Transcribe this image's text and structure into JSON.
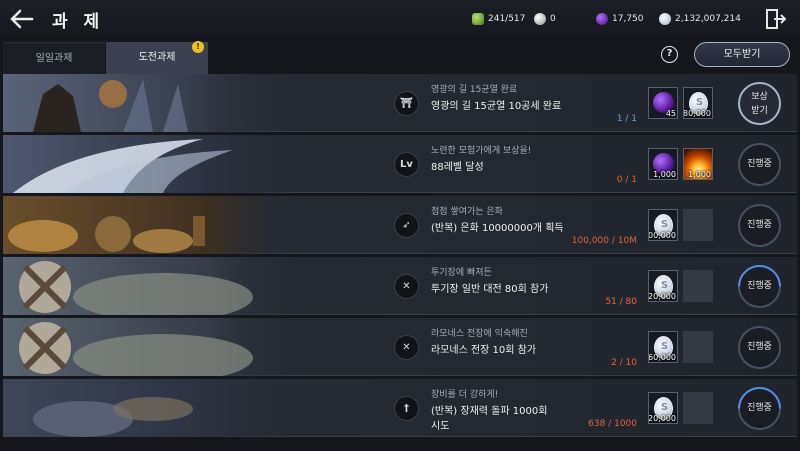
{
  "header": {
    "title": "과 제"
  },
  "resources": [
    {
      "icon": "green-gem-icon",
      "value": "241/517",
      "color": "#7ab648"
    },
    {
      "icon": "pearl-icon",
      "value": "0",
      "color": "#d0d0d0"
    },
    {
      "icon": "purple-orb-icon",
      "value": "17,750",
      "color": "#7a3ad8"
    },
    {
      "icon": "silver-coin-icon",
      "value": "2,132,007,214",
      "color": "#c8d4e6"
    }
  ],
  "tabs": [
    {
      "label": "일일과제",
      "active": false
    },
    {
      "label": "도전과제",
      "active": true,
      "badge": "!"
    }
  ],
  "help_label": "?",
  "claim_all_label": "모두받기",
  "quests": [
    {
      "icon": "gate-icon",
      "icon_text": "⛩",
      "subtitle": "영광의 길 15균열 완료",
      "title": "영광의 길 15균열 10공세 완료",
      "progress": "1 / 1",
      "progress_color": "#5fa8d8",
      "rewards": [
        {
          "type": "purple-orb-icon",
          "count": "45"
        },
        {
          "type": "silver-coin-icon",
          "count": "180,000"
        }
      ],
      "button": "보상\n받기",
      "status": "claim"
    },
    {
      "icon": "level-icon",
      "icon_text": "Lv",
      "subtitle": "노련한 모험가에게 보상을!",
      "title": "88레벨 달성",
      "progress": "0 / 1",
      "progress_color": "#e0663a",
      "rewards": [
        {
          "type": "purple-orb-icon",
          "count": "1,000"
        },
        {
          "type": "fire-box-icon",
          "count": "1,000"
        }
      ],
      "button": "진행중",
      "status": "progress",
      "fraction": 0
    },
    {
      "icon": "coin-hand-icon",
      "icon_text": "➶",
      "subtitle": "점점 쌓여가는 은화",
      "title": "(반복) 은화 10000000개 획득",
      "progress": "100,000 / 10M",
      "progress_color": "#e0663a",
      "rewards": [
        {
          "type": "silver-coin-icon",
          "count": "100,000"
        }
      ],
      "button": "진행중",
      "status": "progress",
      "fraction": 0.01
    },
    {
      "icon": "crossed-swords-icon",
      "icon_text": "✕",
      "subtitle": "투기장에 빠져든",
      "title": "투기장 일반 대전 80회 참가",
      "progress": "51 / 80",
      "progress_color": "#e0663a",
      "rewards": [
        {
          "type": "silver-coin-icon",
          "count": "120,000"
        }
      ],
      "button": "진행중",
      "status": "progress",
      "fraction": 0.64
    },
    {
      "icon": "crossed-swords-icon",
      "icon_text": "✕",
      "subtitle": "라모네스 전장에 익숙해진",
      "title": "라모네스 전장 10회 참가",
      "progress": "2 / 10",
      "progress_color": "#e0663a",
      "rewards": [
        {
          "type": "silver-coin-icon",
          "count": "60,000"
        }
      ],
      "button": "진행중",
      "status": "progress",
      "fraction": 0.2
    },
    {
      "icon": "sword-icon",
      "icon_text": "†",
      "subtitle": "장비를 더 강하게!",
      "title": "(반복) 장재력 돌파 1000회\n시도",
      "progress": "638 / 1000",
      "progress_color": "#e0663a",
      "rewards": [
        {
          "type": "silver-coin-icon",
          "count": "420,000"
        }
      ],
      "button": "진행중",
      "status": "progress",
      "fraction": 0.64
    }
  ]
}
